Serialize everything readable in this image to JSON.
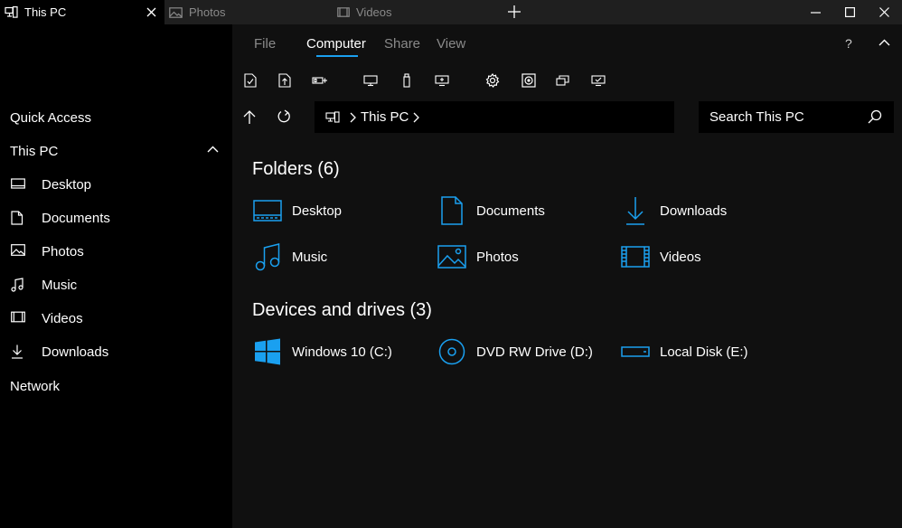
{
  "colors": {
    "accent": "#1aa0f0",
    "background": "#101010",
    "sidebar": "#000000",
    "titlebar": "#1f1f1f",
    "muted_text": "#8a8a8a"
  },
  "tabs": [
    {
      "label": "This PC",
      "icon": "computer-icon",
      "active": true
    },
    {
      "label": "Photos",
      "icon": "image-icon",
      "active": false
    },
    {
      "label": "Videos",
      "icon": "video-icon",
      "active": false
    }
  ],
  "window_controls": [
    "minimize-icon",
    "maximize-icon",
    "close-icon"
  ],
  "sidebar": {
    "quick_access": "Quick Access",
    "this_pc": "This PC",
    "items": [
      {
        "label": "Desktop",
        "icon": "desktop-icon"
      },
      {
        "label": "Documents",
        "icon": "document-icon"
      },
      {
        "label": "Photos",
        "icon": "image-icon"
      },
      {
        "label": "Music",
        "icon": "music-icon"
      },
      {
        "label": "Videos",
        "icon": "video-icon"
      },
      {
        "label": "Downloads",
        "icon": "download-icon"
      }
    ],
    "network": "Network"
  },
  "ribbon": {
    "menu_tabs": [
      "File",
      "Computer",
      "Share",
      "View"
    ],
    "active_menu": "Computer",
    "help": "?",
    "tools": [
      "select-all-icon",
      "upload-icon",
      "connect-icon",
      "display-icon",
      "drive-icon",
      "add-display-icon",
      "settings-icon",
      "disk-icon",
      "manage-icon",
      "remote-icon"
    ]
  },
  "address": {
    "location_icon": "computer-icon",
    "path": "This PC",
    "search_placeholder": "Search This PC"
  },
  "folders": {
    "title": "Folders (6)",
    "items": [
      {
        "label": "Desktop",
        "icon": "desktop-icon"
      },
      {
        "label": "Documents",
        "icon": "document-icon"
      },
      {
        "label": "Downloads",
        "icon": "download-icon"
      },
      {
        "label": "Music",
        "icon": "music-icon"
      },
      {
        "label": "Photos",
        "icon": "image-icon"
      },
      {
        "label": "Videos",
        "icon": "video-icon"
      }
    ]
  },
  "devices": {
    "title": "Devices and drives (3)",
    "items": [
      {
        "label": "Windows 10 (C:)",
        "icon": "windows-logo-icon"
      },
      {
        "label": "DVD RW Drive (D:)",
        "icon": "dvd-icon"
      },
      {
        "label": "Local Disk (E:)",
        "icon": "hard-disk-icon"
      }
    ]
  }
}
